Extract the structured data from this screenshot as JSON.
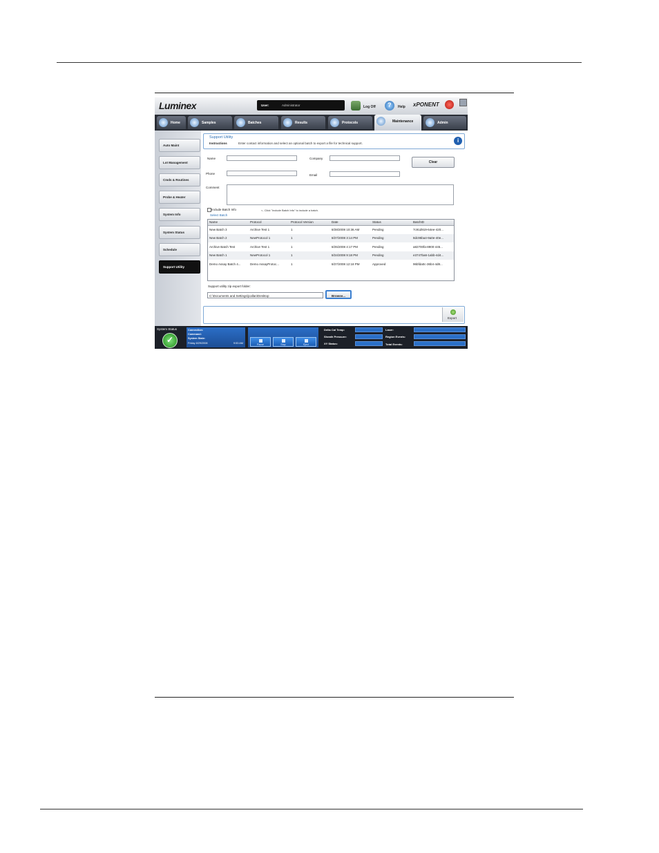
{
  "app": {
    "logo": "Luminex",
    "brand": "xPONENT",
    "user_label": "User:",
    "user_value": "Administrator",
    "logoff_label": "Log Off",
    "help_label": "Help"
  },
  "nav": {
    "tabs": [
      "Home",
      "Samples",
      "Batches",
      "Results",
      "Protocols",
      "Maintenance",
      "Admin"
    ],
    "active": "Maintenance"
  },
  "sidebar": {
    "items": [
      "Auto Maint",
      "Lot Management",
      "Cmds & Routines",
      "Probe & Heater",
      "System Info",
      "System Status",
      "Schedule",
      "Support Utility"
    ],
    "active": "Support Utility"
  },
  "support": {
    "title": "Support Utility",
    "instructions_label": "Instructions",
    "instructions_text": "Enter contact information and select an optional batch to export a file for technical support.",
    "name_label": "Name",
    "company_label": "Company",
    "phone_label": "Phone",
    "email_label": "Email",
    "comment_label": "Comment",
    "clear_label": "Clear",
    "include_label": "Include Batch Info",
    "hint": "<- Click \"Include Batch Info\" to include a batch.",
    "select_batch_label": "Select Batch",
    "columns": [
      "Name",
      "Protocol",
      "Protocol Version",
      "Date",
      "Status",
      "BatchID"
    ],
    "rows": [
      [
        "New Batch 3",
        "Archive Test 1",
        "1",
        "8/28/2008 10:36 AM",
        "Pending",
        "7c91d919-64ee-420..."
      ],
      [
        "New Batch 2",
        "NewProtocol 1",
        "1",
        "8/27/2008 3:14 PM",
        "Pending",
        "8dc95ba4-9a0e-40e..."
      ],
      [
        "Archive Batch Test",
        "Archive Test 1",
        "1",
        "8/25/2008 4:17 PM",
        "Pending",
        "a82700fa-8900-445..."
      ],
      [
        "New Batch 1",
        "NewProtocol 1",
        "1",
        "8/24/2008 9:18 PM",
        "Pending",
        "e3747ba6-1abb-4d4..."
      ],
      [
        "Demo Assay Batch 4...",
        "Demo AssayProtoc...",
        "1",
        "8/27/2008 12:18 PM",
        "Approved",
        "96bfda0c-36b4-4d8..."
      ]
    ],
    "export_folder_label": "Support utility zip export folder:",
    "export_path": "C:\\Documents and Settings\\jcallan\\Desktop",
    "browse_label": "Browse...",
    "export_label": "Export"
  },
  "status": {
    "system_status_label": "System Status",
    "connection_label": "Connection:",
    "command_label": "Command:",
    "system_state_label": "System State:",
    "datetime": "Friday 8/29/2008",
    "time": "9:53 AM",
    "buttons": [
      "Pause",
      "Stop",
      "Eject"
    ],
    "indicators_left": [
      "Delta Cal Temp:",
      "Sheath Pressure:",
      "XY Status:"
    ],
    "indicators_right": [
      "Laser:",
      "Region Events:",
      "Total Events:"
    ]
  }
}
